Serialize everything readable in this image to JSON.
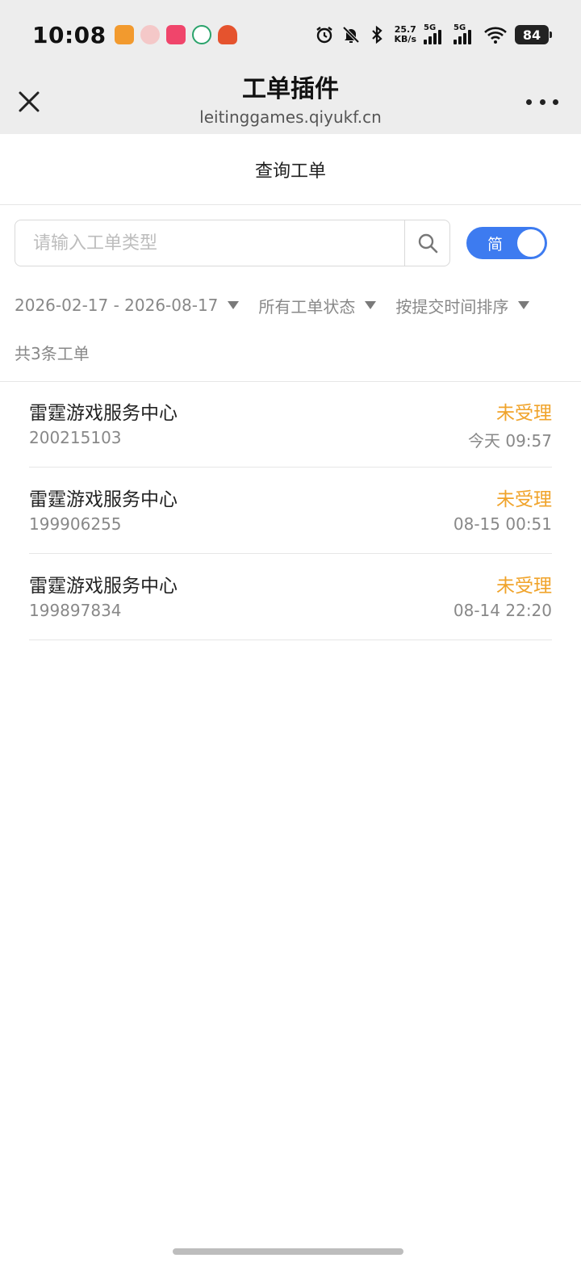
{
  "status_bar": {
    "time": "10:08",
    "net_speed_value": "25.7",
    "net_speed_unit": "KB/s",
    "signal1_label": "5G",
    "signal2_label": "5G",
    "battery": "84",
    "notif_colors": [
      "#f29a2e",
      "#f4c8c8",
      "#f0456b",
      "#2aa36b",
      "#e5532e"
    ]
  },
  "titlebar": {
    "title": "工单插件",
    "url": "leitinggames.qiyukf.cn"
  },
  "header": {
    "title": "查询工单"
  },
  "search": {
    "placeholder": "请输入工单类型",
    "value": ""
  },
  "toggle": {
    "label": "简",
    "on": true,
    "color": "#3d7bf0"
  },
  "filters": {
    "date_range": "2026-02-17 - 2026-08-17",
    "status": "所有工单状态",
    "sort": "按提交时间排序"
  },
  "count_text": "共3条工单",
  "tickets": [
    {
      "name": "雷霆游戏服务中心",
      "id": "200215103",
      "status": "未受理",
      "time": "今天 09:57"
    },
    {
      "name": "雷霆游戏服务中心",
      "id": "199906255",
      "status": "未受理",
      "time": "08-15 00:51"
    },
    {
      "name": "雷霆游戏服务中心",
      "id": "199897834",
      "status": "未受理",
      "time": "08-14 22:20"
    }
  ],
  "colors": {
    "status_pending": "#f0a32a",
    "accent": "#3d7bf0"
  },
  "icons": {
    "close": "close-icon",
    "more": "more-dots-icon",
    "search": "search-icon",
    "caret": "caret-down-icon"
  }
}
